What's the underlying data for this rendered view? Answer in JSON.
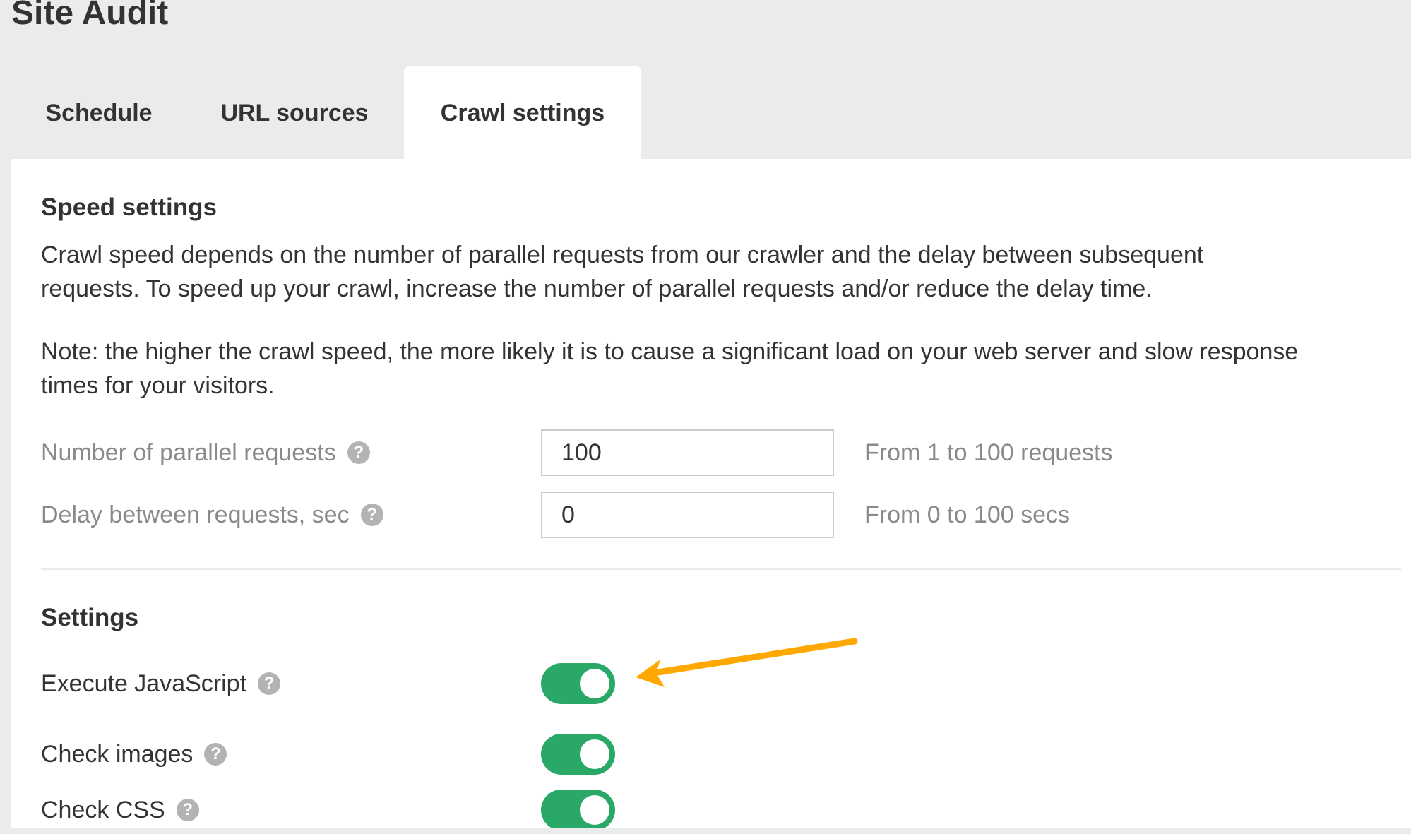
{
  "header": {
    "title": "Site Audit"
  },
  "tabs": [
    {
      "label": "Schedule",
      "active": false
    },
    {
      "label": "URL sources",
      "active": false
    },
    {
      "label": "Crawl settings",
      "active": true
    }
  ],
  "speed_settings": {
    "title": "Speed settings",
    "description_lines": [
      "Crawl speed depends on the number of parallel requests from our crawler and the delay between subsequent",
      "requests. To speed up your crawl, increase the number of parallel requests and/or reduce the delay time."
    ],
    "note_lines": [
      "Note: the higher the crawl speed, the more likely it is to cause a significant load on your web server and slow response",
      "times for your visitors."
    ],
    "fields": [
      {
        "label": "Number of parallel requests",
        "value": "100",
        "hint": "From 1 to 100 requests",
        "help_icon": "question-circle-icon"
      },
      {
        "label": "Delay between requests, sec",
        "value": "0",
        "hint": "From 0 to 100 secs",
        "help_icon": "question-circle-icon"
      }
    ]
  },
  "settings": {
    "title": "Settings",
    "toggles": [
      {
        "label": "Execute JavaScript",
        "on": true,
        "help_icon": "question-circle-icon"
      },
      {
        "label": "Check images",
        "on": true,
        "help_icon": "question-circle-icon"
      },
      {
        "label": "Check CSS",
        "on": true,
        "help_icon": "question-circle-icon"
      }
    ]
  },
  "help_glyph": "?",
  "annotation": {
    "type": "arrow",
    "points_to": "Execute JavaScript toggle",
    "color": "#ffa800"
  },
  "colors": {
    "background": "#eaebed",
    "panel": "#ffffff",
    "text": "#333333",
    "muted_text": "#8a8a8a",
    "toggle_on": "#2aa868",
    "help_icon": "#b3b3b3",
    "input_border": "#cccccc"
  }
}
